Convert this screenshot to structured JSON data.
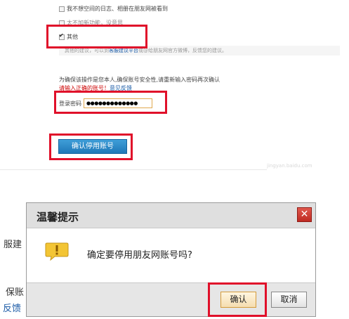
{
  "form": {
    "options": [
      {
        "label": "我不想空间的日志、相册在朋友网被看到",
        "checked": false
      },
      {
        "label": "太不加新功能，没意思",
        "checked": false
      },
      {
        "label": "其他",
        "checked": true
      }
    ],
    "suggestion": {
      "prefix": "其他的建议，可以到",
      "link": "客服建议平台",
      "suffix": "或@给朋友网官方微博，反馈您的建议。"
    },
    "hint_line1": "为确保该操作是您本人,确保账号安全性,请重新输入密码再次确认",
    "hint_line2_prefix": "请输入正确的账号！",
    "hint_line2_link": "意见反馈",
    "password_label": "登录密码",
    "password_value": "●●●●●●●●●●●●●",
    "confirm_stop_button": "确认停用账号"
  },
  "watermark": "jingyan.baidu.com",
  "background_fragments": {
    "frag1": "服建",
    "frag2": "保账",
    "frag3": "反馈"
  },
  "dialog": {
    "title": "温馨提示",
    "close_symbol": "✕",
    "icon": "warning-icon",
    "message": "确定要停用朋友网账号吗?",
    "ok_label": "确认",
    "cancel_label": "取消"
  },
  "colors": {
    "highlight_red": "#e0102a",
    "button_blue": "#1f78b8",
    "warning_yellow": "#f2c230",
    "close_red": "#d0382e"
  }
}
